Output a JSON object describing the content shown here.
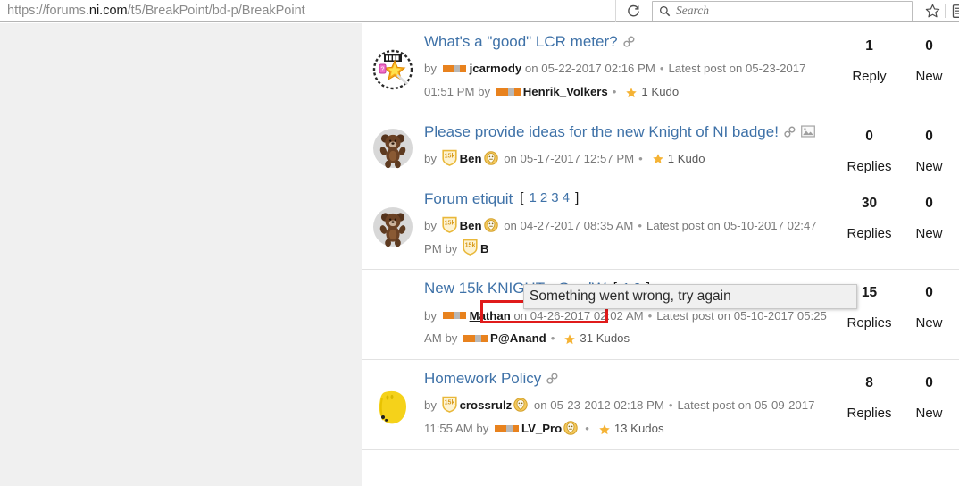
{
  "browser": {
    "url_prefix": "https://forums.",
    "url_domain": "ni.com",
    "url_suffix": "/t5/BreakPoint/bd-p/BreakPoint",
    "reload_icon": "reload-icon",
    "search_icon": "search-icon",
    "search_placeholder": "Search",
    "bookmark_icon": "star-icon",
    "library_icon": "library-icon",
    "download_icon": "download-arrow-icon",
    "edge_icon": "partial-icon"
  },
  "overlay": {
    "tooltip_text": "Something went wrong, try again"
  },
  "colors": {
    "link": "#3f72a8",
    "meta": "#7a7a7a",
    "highlight": "#e01b1b",
    "kudo_star": "#f5b335",
    "rank_orange": "#e8821e",
    "panel_bg": "#ffffff",
    "gutter_bg": "#f0f0f0"
  },
  "topics": [
    {
      "avatar": "star-wand-avatar",
      "title": "What's a \"good\" LCR meter?",
      "pages": [],
      "title_icons": [
        "link-icon"
      ],
      "meta_line1_prefix": "by",
      "author_rank": "rank-blocks",
      "author": "jcarmody",
      "author_badges": [],
      "posted_label": "on",
      "posted_date": "05-22-2017 02:16 PM",
      "latest_label": "Latest post on",
      "latest_date": "05-23-2017 01:51 PM",
      "latest_by_label": "by",
      "latest_rank": "rank-blocks",
      "latest_author": "Henrik_Volkers",
      "latest_badges": [],
      "kudos": "1 Kudo",
      "count1_num": "1",
      "count1_label": "Reply",
      "count2_num": "0",
      "count2_label": "New",
      "highlight": false
    },
    {
      "avatar": "teddy-bear-avatar",
      "title": "Please provide ideas for the new Knight of NI badge!",
      "pages": [],
      "title_icons": [
        "link-icon",
        "image-icon"
      ],
      "meta_line1_prefix": "by",
      "author_rank": "badge-15k",
      "author": "Ben",
      "author_badges": [
        "knight-helmet-icon"
      ],
      "posted_label": "on",
      "posted_date": "05-17-2017 12:57 PM",
      "latest_label": "",
      "latest_date": "",
      "latest_by_label": "",
      "latest_rank": "",
      "latest_author": "",
      "latest_badges": [],
      "kudos": "1 Kudo",
      "count1_num": "0",
      "count1_label": "Replies",
      "count2_num": "0",
      "count2_label": "New",
      "highlight": false
    },
    {
      "avatar": "teddy-bear-avatar",
      "title": "Forum etiquit",
      "pages": [
        "1",
        "2",
        "3",
        "4"
      ],
      "title_icons": [],
      "meta_line1_prefix": "by",
      "author_rank": "badge-15k",
      "author": "Ben",
      "author_badges": [
        "knight-helmet-icon"
      ],
      "posted_label": "on",
      "posted_date": "04-27-2017 08:35 AM",
      "latest_label": "Latest post on",
      "latest_date": "05-10-2017 02:47 PM",
      "latest_by_label": "by",
      "latest_rank": "badge-15k",
      "latest_author": "B",
      "latest_badges": [],
      "kudos": "",
      "count1_num": "30",
      "count1_label": "Replies",
      "count2_num": "0",
      "count2_label": "New",
      "highlight": false
    },
    {
      "avatar": "",
      "title": "New 15k KNIGHT - GerdW",
      "pages": [
        "1",
        "2"
      ],
      "title_icons": [],
      "meta_line1_prefix": "by",
      "author_rank": "rank-blocks",
      "author": "Mathan",
      "author_badges": [],
      "posted_label": "on",
      "posted_date": "04-26-2017 02:02 AM",
      "latest_label": "Latest post on",
      "latest_date": "05-10-2017 05:25 AM",
      "latest_by_label": "by",
      "latest_rank": "rank-blocks",
      "latest_author": "P@Anand",
      "latest_badges": [],
      "kudos": "31 Kudos",
      "count1_num": "15",
      "count1_label": "Replies",
      "count2_num": "0",
      "count2_label": "New",
      "highlight": true
    },
    {
      "avatar": "yellow-blob-avatar",
      "title": "Homework Policy",
      "pages": [],
      "title_icons": [
        "link-icon"
      ],
      "meta_line1_prefix": "by",
      "author_rank": "badge-15k",
      "author": "crossrulz",
      "author_badges": [
        "knight-helmet-icon"
      ],
      "posted_label": "on",
      "posted_date": "05-23-2012 02:18 PM",
      "latest_label": "Latest post on",
      "latest_date": "05-09-2017 11:55 AM",
      "latest_by_label": "by",
      "latest_rank": "rank-blocks",
      "latest_author": "LV_Pro",
      "latest_badges": [
        "knight-helmet-icon"
      ],
      "kudos": "13 Kudos",
      "count1_num": "8",
      "count1_label": "Replies",
      "count2_num": "0",
      "count2_label": "New",
      "highlight": false
    }
  ]
}
